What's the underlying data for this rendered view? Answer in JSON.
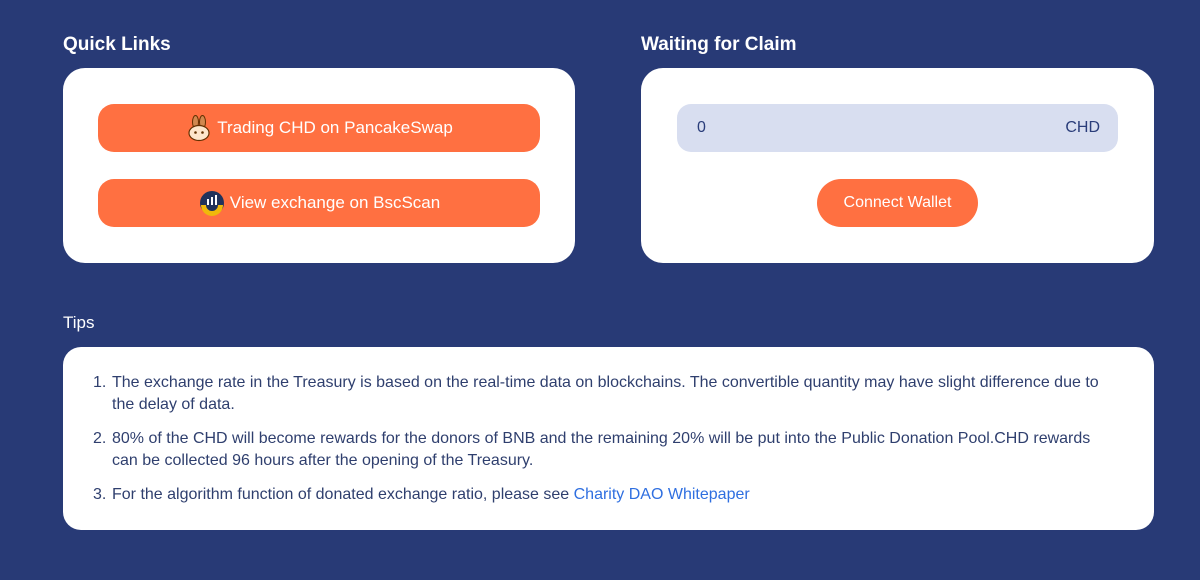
{
  "quick_links": {
    "title": "Quick Links",
    "pancake_label": "Trading CHD on PancakeSwap",
    "bscscan_label": "View exchange on BscScan"
  },
  "claim": {
    "title": "Waiting for Claim",
    "amount": "0",
    "unit": "CHD",
    "connect_label": "Connect Wallet"
  },
  "tips": {
    "title": "Tips",
    "items": [
      {
        "num": "1.",
        "text": "The exchange rate in the Treasury is based on the real-time data on blockchains. The convertible quantity may have slight difference due to the delay of data."
      },
      {
        "num": "2.",
        "text": "80% of the CHD will become rewards for the donors of BNB and the remaining 20% will be put into the Public Donation Pool.CHD rewards can be collected 96 hours after the opening of the Treasury."
      },
      {
        "num": "3.",
        "text": "For the algorithm function of donated exchange ratio, please see ",
        "link": "Charity DAO Whitepaper"
      }
    ]
  },
  "colors": {
    "background": "#283a76",
    "accent": "#ff7041",
    "link": "#2f6fe0",
    "field": "#d8def0"
  },
  "icons": {
    "pancake": "pancakeswap-bunny-icon",
    "bscscan": "bscscan-icon"
  }
}
